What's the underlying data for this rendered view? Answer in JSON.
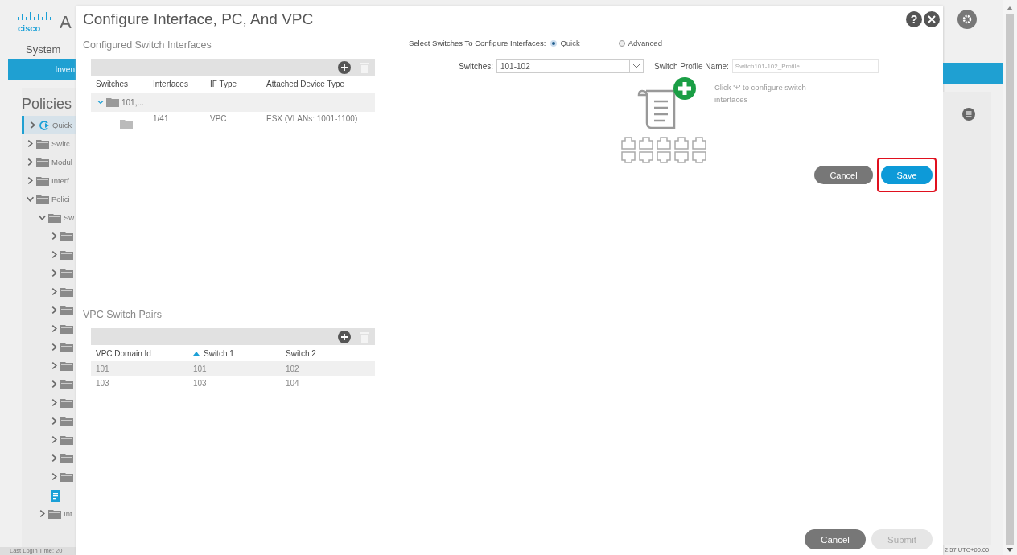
{
  "app": {
    "logo": "cisco",
    "title_partial": "A",
    "nav_item": "System",
    "tab_partial": "Inven",
    "section_title": "Policies",
    "tree": [
      {
        "label": "Quick",
        "kind": "quick",
        "selected": true,
        "expanded": false
      },
      {
        "label": "Switc",
        "kind": "folder",
        "selected": false,
        "expanded": false
      },
      {
        "label": "Modul",
        "kind": "folder",
        "selected": false,
        "expanded": false
      },
      {
        "label": "Interf",
        "kind": "folder",
        "selected": false,
        "expanded": false
      },
      {
        "label": "Polici",
        "kind": "folder",
        "selected": false,
        "expanded": true,
        "children": [
          {
            "label": "Sw",
            "kind": "folder",
            "selected": false,
            "expanded": true,
            "children": [
              {
                "kind": "folder",
                "selected": false,
                "expanded": false
              },
              {
                "kind": "folder",
                "selected": false,
                "expanded": false
              },
              {
                "kind": "folder",
                "selected": false,
                "expanded": false
              },
              {
                "kind": "folder",
                "selected": false,
                "expanded": false
              },
              {
                "kind": "folder",
                "selected": false,
                "expanded": false
              },
              {
                "kind": "folder",
                "selected": false,
                "expanded": false
              },
              {
                "kind": "folder",
                "selected": false,
                "expanded": false
              },
              {
                "kind": "folder",
                "selected": false,
                "expanded": false
              },
              {
                "kind": "folder",
                "selected": false,
                "expanded": false
              },
              {
                "kind": "folder",
                "selected": false,
                "expanded": false
              },
              {
                "kind": "folder",
                "selected": false,
                "expanded": false
              },
              {
                "kind": "folder",
                "selected": false,
                "expanded": false
              },
              {
                "kind": "folder",
                "selected": false,
                "expanded": false
              },
              {
                "kind": "folder",
                "selected": false,
                "expanded": false
              },
              {
                "kind": "document",
                "selected": false
              }
            ]
          },
          {
            "label": "Int",
            "kind": "folder",
            "selected": false,
            "expanded": false
          }
        ]
      }
    ],
    "footer_left": "Last Login Time: 20",
    "footer_right": "2:57 UTC+00:00"
  },
  "dialog": {
    "title": "Configure Interface, PC, And VPC",
    "help_icon": "?",
    "interfaces": {
      "title": "Configured Switch Interfaces",
      "columns": [
        "Switches",
        "Interfaces",
        "IF Type",
        "Attached Device Type"
      ],
      "rows": [
        {
          "kind": "group",
          "label": "101,...",
          "expanded": true,
          "selected": true
        },
        {
          "kind": "interface",
          "cells": [
            "1/41",
            "VPC",
            "ESX (VLANs: 1001-1100)"
          ],
          "selected": false
        }
      ]
    },
    "vpc_pairs": {
      "title": "VPC Switch Pairs",
      "columns": [
        {
          "label": "VPC Domain Id",
          "sorted": false
        },
        {
          "label": "Switch 1",
          "sorted": true
        },
        {
          "label": "Switch 2",
          "sorted": false
        }
      ],
      "rows": [
        {
          "cells": [
            "101",
            "101",
            "102"
          ],
          "selected": true
        },
        {
          "cells": [
            "103",
            "103",
            "104"
          ],
          "selected": false
        }
      ]
    },
    "mode_label": "Select Switches To Configure Interfaces:",
    "modes": [
      {
        "label": "Quick",
        "selected": true
      },
      {
        "label": "Advanced",
        "selected": false
      }
    ],
    "switches": {
      "label": "Switches:",
      "value": "101-102"
    },
    "profile": {
      "label": "Switch Profile Name:",
      "placeholder": "Switch101-102_Profile"
    },
    "hint": "Click '+' to configure switch interfaces",
    "actions": [
      {
        "label": "Cancel",
        "kind": "secondary",
        "highlighted": false
      },
      {
        "label": "Save",
        "kind": "primary",
        "highlighted": true
      }
    ],
    "footer": [
      {
        "label": "Cancel",
        "disabled": false
      },
      {
        "label": "Submit",
        "disabled": true
      }
    ]
  }
}
